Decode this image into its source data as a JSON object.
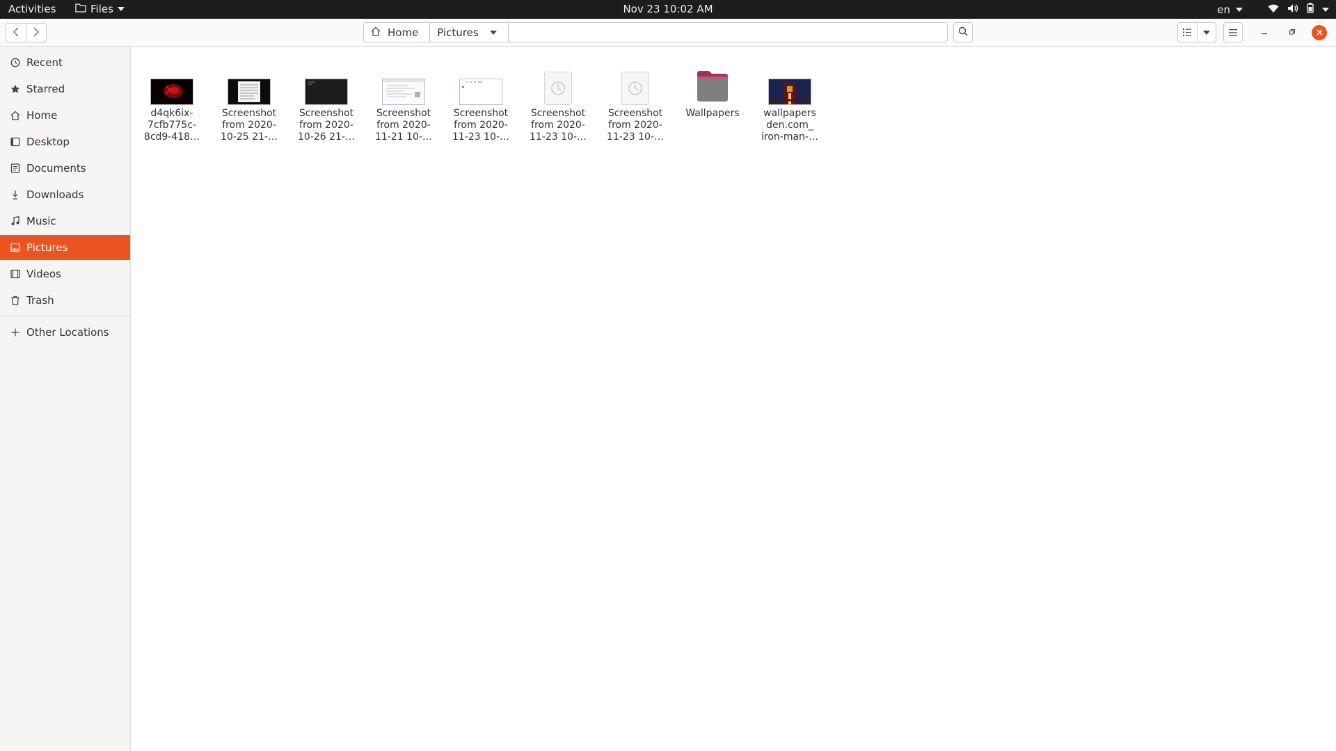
{
  "topbar": {
    "activities": "Activities",
    "app_menu": "Files",
    "clock": "Nov 23  10:02 AM",
    "lang": "en"
  },
  "headerbar": {
    "breadcrumbs": [
      "Home",
      "Pictures"
    ]
  },
  "sidebar": {
    "items": [
      {
        "label": "Recent",
        "icon": "clock-icon"
      },
      {
        "label": "Starred",
        "icon": "star-icon"
      },
      {
        "label": "Home",
        "icon": "home-icon"
      },
      {
        "label": "Desktop",
        "icon": "desktop-icon"
      },
      {
        "label": "Documents",
        "icon": "document-icon"
      },
      {
        "label": "Downloads",
        "icon": "download-icon"
      },
      {
        "label": "Music",
        "icon": "music-icon"
      },
      {
        "label": "Pictures",
        "icon": "picture-icon",
        "active": true
      },
      {
        "label": "Videos",
        "icon": "video-icon"
      },
      {
        "label": "Trash",
        "icon": "trash-icon"
      }
    ],
    "other_locations": "Other Locations"
  },
  "files": [
    {
      "name": "d4qk6ix-\n7cfb775c-\n8cd9-418…",
      "kind": "red-image"
    },
    {
      "name": "Screenshot\nfrom 2020-\n10-25 21-…",
      "kind": "screenshot-dark-doc"
    },
    {
      "name": "Screenshot\nfrom 2020-\n10-26 21-…",
      "kind": "screenshot-dark"
    },
    {
      "name": "Screenshot\nfrom 2020-\n11-21 10-…",
      "kind": "screenshot-light"
    },
    {
      "name": "Screenshot\nfrom 2020-\n11-23 10-…",
      "kind": "screenshot-white"
    },
    {
      "name": "Screenshot\nfrom 2020-\n11-23 10-…",
      "kind": "pending"
    },
    {
      "name": "Screenshot\nfrom 2020-\n11-23 10-…",
      "kind": "pending"
    },
    {
      "name": "Wallpapers",
      "kind": "folder"
    },
    {
      "name": "wallpapers\nden.com_\niron-man-…",
      "kind": "iron-man-image"
    }
  ],
  "colors": {
    "accent": "#e95420",
    "topbar": "#1d1d1d",
    "sidebar": "#f6f5f4"
  }
}
